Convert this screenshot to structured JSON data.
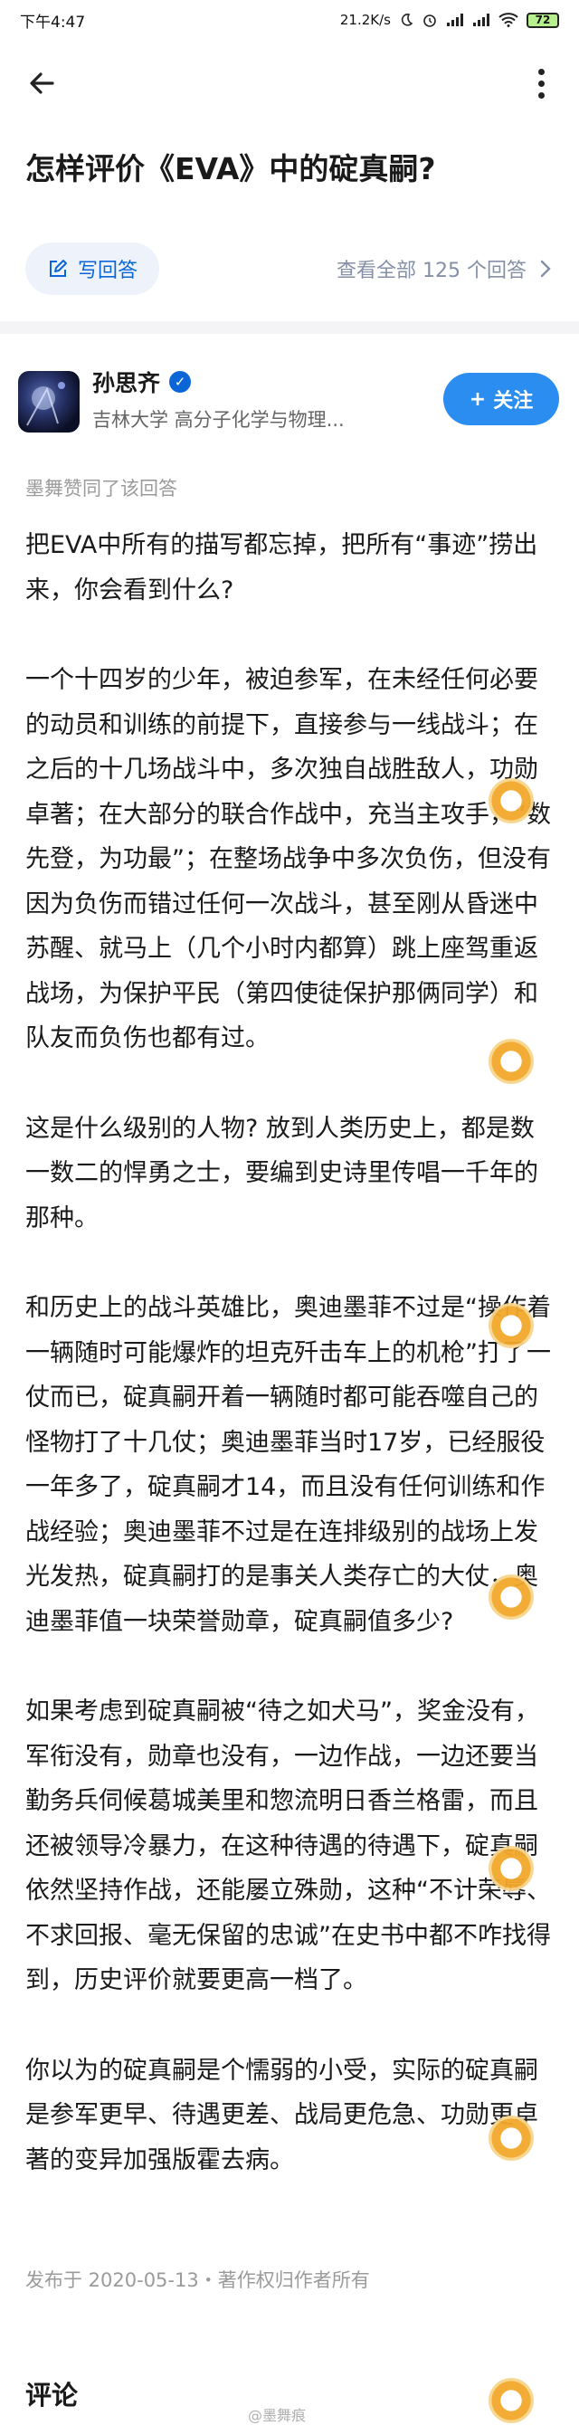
{
  "status_bar": {
    "time": "下午4:47",
    "network_speed": "21.2K/s",
    "battery": "72",
    "icons": [
      "moon-icon",
      "alarm-icon",
      "signal-icon",
      "signal-icon",
      "wifi-icon",
      "battery-icon"
    ]
  },
  "top_bar": {
    "back_icon": "arrow-left-icon",
    "more_icon": "more-vertical-icon"
  },
  "question": {
    "title": "怎样评价《EVA》中的碇真嗣?"
  },
  "actions": {
    "write_answer": "写回答",
    "view_all": "查看全部 125 个回答",
    "accent": "#0a66d6"
  },
  "author": {
    "name": "孙思齐",
    "description": "吉林大学 高分子化学与物理...",
    "follow_label": "关注",
    "follow_color": "#2b8df0"
  },
  "liked_by": "墨舞赞同了该回答",
  "answer": {
    "paragraphs": [
      "把EVA中所有的描写都忘掉，把所有“事迹”捞出来，你会看到什么?",
      "一个十四岁的少年，被迫参军，在未经任何必要的动员和训练的前提下，直接参与一线战斗；在之后的十几场战斗中，多次独自战胜敌人，功勋卓著；在大部分的联合作战中，充当主攻手，“数先登，为功最”；在整场战争中多次负伤，但没有因为负伤而错过任何一次战斗，甚至刚从昏迷中苏醒、就马上（几个小时内都算）跳上座驾重返战场，为保护平民（第四使徒保护那俩同学）和队友而负伤也都有过。",
      "这是什么级别的人物? 放到人类历史上，都是数一数二的悍勇之士，要编到史诗里传唱一千年的那种。",
      "和历史上的战斗英雄比，奥迪墨菲不过是“操作着一辆随时可能爆炸的坦克歼击车上的机枪”打了一仗而已，碇真嗣开着一辆随时都可能吞噬自己的怪物打了十几仗；奥迪墨菲当时17岁，已经服役一年多了，碇真嗣才14，而且没有任何训练和作战经验；奥迪墨菲不过是在连排级别的战场上发光发热，碇真嗣打的是事关人类存亡的大仗，奥迪墨菲值一块荣誉勋章，碇真嗣值多少?",
      "如果考虑到碇真嗣被“待之如犬马”，奖金没有，军衔没有，勋章也没有，一边作战，一边还要当勤务兵伺候葛城美里和惣流明日香兰格雷，而且还被领导冷暴力，在这种待遇的待遇下，碇真嗣依然坚持作战，还能屡立殊勋，这种“不计荣辱、不求回报、毫无保留的忠诚”在史书中都不咋找得到，历史评价就要更高一档了。",
      "你以为的碇真嗣是个懦弱的小受，实际的碇真嗣是参军更早、待遇更差、战局更危急、功勋更卓著的变异加强版霍去病。"
    ]
  },
  "footer": {
    "published": "发布于 2020-05-13・著作权归作者所有",
    "comments_title": "评论",
    "watermark": "@墨舞痕"
  }
}
